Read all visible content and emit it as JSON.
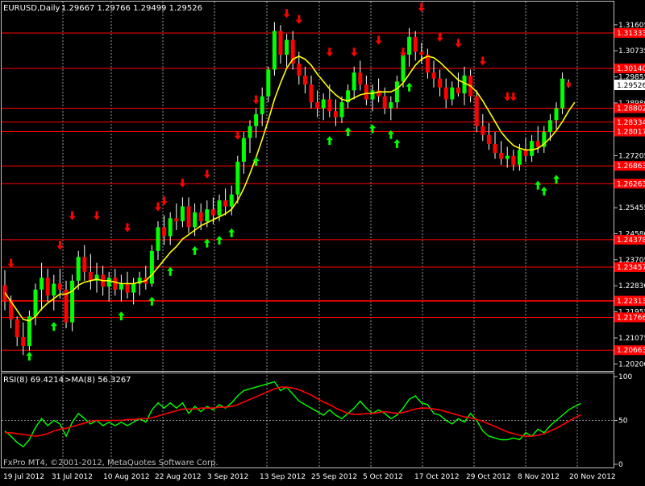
{
  "header": {
    "symbol": "EURUSD,Daily",
    "ohlc": "1.29667 1.29766 1.29499 1.29526"
  },
  "footer": {
    "copyright": "FxPro MT4, ©2001-2012, MetaQuotes Software Corp."
  },
  "colors": {
    "background": "#000000",
    "frame": "#c0c0c0",
    "bull": "#00ff00",
    "bear": "#ff0000",
    "ma_line": "#ffff00",
    "level_line": "#ff0000",
    "grid": "#c0c0c0",
    "rsi_line": "#00ff00",
    "rsi_ma_line": "#ff0000",
    "current_label_bg": "#ffffff"
  },
  "icons": {
    "up_arrow": "green-up-arrow-icon",
    "down_arrow": "red-down-arrow-icon"
  },
  "price_axis": {
    "ticks": [
      "1.31605",
      "1.30735",
      "1.29855",
      "1.28980",
      "1.28105",
      "1.27205",
      "1.26330",
      "1.25455",
      "1.24580",
      "1.23705",
      "1.22830",
      "1.21955",
      "1.21075",
      "1.20200"
    ],
    "level_labels": [
      "1.31333",
      "1.30140",
      "1.28802",
      "1.28334",
      "1.28017",
      "1.26863",
      "1.26263",
      "1.24378",
      "1.23457",
      "1.22330",
      "1.22313",
      "1.21766",
      "1.20663"
    ],
    "current_price": "1.29526"
  },
  "date_axis": {
    "labels": [
      "19 Jul 2012",
      "31 Jul 2012",
      "10 Aug 2012",
      "22 Aug 2012",
      "3 Sep 2012",
      "13 Sep 2012",
      "25 Sep 2012",
      "5 Oct 2012",
      "17 Oct 2012",
      "29 Oct 2012",
      "8 Nov 2012",
      "20 Nov 2012"
    ]
  },
  "rsi_panel": {
    "title": "RSI(8) 69.4214",
    "ma_title": ">MA(8) 56.3267",
    "ticks": [
      "100",
      "50",
      "0"
    ]
  },
  "chart_data": [
    {
      "type": "candlestick",
      "title": "EURUSD,Daily",
      "x": [
        "19 Jul 2012",
        "31 Jul 2012",
        "10 Aug 2012",
        "22 Aug 2012",
        "3 Sep 2012",
        "13 Sep 2012",
        "25 Sep 2012",
        "5 Oct 2012",
        "17 Oct 2012",
        "29 Oct 2012",
        "8 Nov 2012",
        "20 Nov 2012"
      ],
      "ylim": [
        1.201,
        1.319
      ],
      "grid": true,
      "candles": [
        {
          "o": 1.2285,
          "h": 1.2335,
          "l": 1.22,
          "c": 1.223
        },
        {
          "o": 1.223,
          "h": 1.225,
          "l": 1.214,
          "c": 1.217
        },
        {
          "o": 1.217,
          "h": 1.218,
          "l": 1.208,
          "c": 1.211
        },
        {
          "o": 1.211,
          "h": 1.216,
          "l": 1.205,
          "c": 1.208
        },
        {
          "o": 1.208,
          "h": 1.22,
          "l": 1.2065,
          "c": 1.218
        },
        {
          "o": 1.218,
          "h": 1.229,
          "l": 1.215,
          "c": 1.227
        },
        {
          "o": 1.227,
          "h": 1.236,
          "l": 1.22,
          "c": 1.231
        },
        {
          "o": 1.231,
          "h": 1.234,
          "l": 1.223,
          "c": 1.225
        },
        {
          "o": 1.225,
          "h": 1.232,
          "l": 1.22,
          "c": 1.229
        },
        {
          "o": 1.229,
          "h": 1.234,
          "l": 1.224,
          "c": 1.227
        },
        {
          "o": 1.227,
          "h": 1.23,
          "l": 1.214,
          "c": 1.216
        },
        {
          "o": 1.216,
          "h": 1.232,
          "l": 1.213,
          "c": 1.23
        },
        {
          "o": 1.23,
          "h": 1.24,
          "l": 1.227,
          "c": 1.238
        },
        {
          "o": 1.238,
          "h": 1.242,
          "l": 1.23,
          "c": 1.233
        },
        {
          "o": 1.233,
          "h": 1.239,
          "l": 1.227,
          "c": 1.23
        },
        {
          "o": 1.23,
          "h": 1.236,
          "l": 1.226,
          "c": 1.232
        },
        {
          "o": 1.232,
          "h": 1.235,
          "l": 1.225,
          "c": 1.228
        },
        {
          "o": 1.228,
          "h": 1.233,
          "l": 1.223,
          "c": 1.231
        },
        {
          "o": 1.231,
          "h": 1.234,
          "l": 1.225,
          "c": 1.227
        },
        {
          "o": 1.227,
          "h": 1.232,
          "l": 1.223,
          "c": 1.229
        },
        {
          "o": 1.229,
          "h": 1.233,
          "l": 1.224,
          "c": 1.226
        },
        {
          "o": 1.226,
          "h": 1.231,
          "l": 1.222,
          "c": 1.229
        },
        {
          "o": 1.229,
          "h": 1.233,
          "l": 1.225,
          "c": 1.231
        },
        {
          "o": 1.231,
          "h": 1.235,
          "l": 1.227,
          "c": 1.229
        },
        {
          "o": 1.229,
          "h": 1.242,
          "l": 1.228,
          "c": 1.24
        },
        {
          "o": 1.24,
          "h": 1.25,
          "l": 1.237,
          "c": 1.248
        },
        {
          "o": 1.248,
          "h": 1.252,
          "l": 1.242,
          "c": 1.245
        },
        {
          "o": 1.245,
          "h": 1.253,
          "l": 1.242,
          "c": 1.251
        },
        {
          "o": 1.251,
          "h": 1.256,
          "l": 1.247,
          "c": 1.25
        },
        {
          "o": 1.25,
          "h": 1.258,
          "l": 1.248,
          "c": 1.255
        },
        {
          "o": 1.255,
          "h": 1.258,
          "l": 1.246,
          "c": 1.248
        },
        {
          "o": 1.248,
          "h": 1.256,
          "l": 1.245,
          "c": 1.253
        },
        {
          "o": 1.253,
          "h": 1.256,
          "l": 1.247,
          "c": 1.25
        },
        {
          "o": 1.25,
          "h": 1.257,
          "l": 1.248,
          "c": 1.254
        },
        {
          "o": 1.254,
          "h": 1.258,
          "l": 1.249,
          "c": 1.252
        },
        {
          "o": 1.252,
          "h": 1.259,
          "l": 1.25,
          "c": 1.257
        },
        {
          "o": 1.257,
          "h": 1.261,
          "l": 1.252,
          "c": 1.255
        },
        {
          "o": 1.255,
          "h": 1.262,
          "l": 1.252,
          "c": 1.259
        },
        {
          "o": 1.259,
          "h": 1.272,
          "l": 1.256,
          "c": 1.27
        },
        {
          "o": 1.27,
          "h": 1.28,
          "l": 1.266,
          "c": 1.278
        },
        {
          "o": 1.278,
          "h": 1.284,
          "l": 1.273,
          "c": 1.282
        },
        {
          "o": 1.282,
          "h": 1.288,
          "l": 1.278,
          "c": 1.286
        },
        {
          "o": 1.286,
          "h": 1.295,
          "l": 1.282,
          "c": 1.292
        },
        {
          "o": 1.292,
          "h": 1.302,
          "l": 1.29,
          "c": 1.301
        },
        {
          "o": 1.301,
          "h": 1.317,
          "l": 1.299,
          "c": 1.314
        },
        {
          "o": 1.314,
          "h": 1.316,
          "l": 1.303,
          "c": 1.306
        },
        {
          "o": 1.306,
          "h": 1.313,
          "l": 1.302,
          "c": 1.311
        },
        {
          "o": 1.311,
          "h": 1.314,
          "l": 1.301,
          "c": 1.303
        },
        {
          "o": 1.303,
          "h": 1.307,
          "l": 1.296,
          "c": 1.299
        },
        {
          "o": 1.299,
          "h": 1.302,
          "l": 1.293,
          "c": 1.296
        },
        {
          "o": 1.296,
          "h": 1.299,
          "l": 1.288,
          "c": 1.29
        },
        {
          "o": 1.29,
          "h": 1.294,
          "l": 1.285,
          "c": 1.288
        },
        {
          "o": 1.288,
          "h": 1.293,
          "l": 1.284,
          "c": 1.291
        },
        {
          "o": 1.291,
          "h": 1.296,
          "l": 1.285,
          "c": 1.287
        },
        {
          "o": 1.287,
          "h": 1.291,
          "l": 1.282,
          "c": 1.285
        },
        {
          "o": 1.285,
          "h": 1.292,
          "l": 1.283,
          "c": 1.29
        },
        {
          "o": 1.29,
          "h": 1.296,
          "l": 1.288,
          "c": 1.294
        },
        {
          "o": 1.294,
          "h": 1.302,
          "l": 1.291,
          "c": 1.3
        },
        {
          "o": 1.3,
          "h": 1.304,
          "l": 1.294,
          "c": 1.296
        },
        {
          "o": 1.296,
          "h": 1.299,
          "l": 1.289,
          "c": 1.291
        },
        {
          "o": 1.291,
          "h": 1.296,
          "l": 1.287,
          "c": 1.294
        },
        {
          "o": 1.294,
          "h": 1.298,
          "l": 1.29,
          "c": 1.292
        },
        {
          "o": 1.292,
          "h": 1.295,
          "l": 1.286,
          "c": 1.288
        },
        {
          "o": 1.288,
          "h": 1.292,
          "l": 1.284,
          "c": 1.29
        },
        {
          "o": 1.29,
          "h": 1.299,
          "l": 1.288,
          "c": 1.297
        },
        {
          "o": 1.297,
          "h": 1.308,
          "l": 1.295,
          "c": 1.306
        },
        {
          "o": 1.306,
          "h": 1.315,
          "l": 1.302,
          "c": 1.312
        },
        {
          "o": 1.312,
          "h": 1.314,
          "l": 1.304,
          "c": 1.307
        },
        {
          "o": 1.307,
          "h": 1.31,
          "l": 1.303,
          "c": 1.306
        },
        {
          "o": 1.306,
          "h": 1.308,
          "l": 1.298,
          "c": 1.3
        },
        {
          "o": 1.3,
          "h": 1.304,
          "l": 1.295,
          "c": 1.298
        },
        {
          "o": 1.298,
          "h": 1.301,
          "l": 1.292,
          "c": 1.295
        },
        {
          "o": 1.295,
          "h": 1.298,
          "l": 1.288,
          "c": 1.291
        },
        {
          "o": 1.291,
          "h": 1.297,
          "l": 1.289,
          "c": 1.295
        },
        {
          "o": 1.295,
          "h": 1.3,
          "l": 1.292,
          "c": 1.293
        },
        {
          "o": 1.293,
          "h": 1.302,
          "l": 1.289,
          "c": 1.299
        },
        {
          "o": 1.299,
          "h": 1.301,
          "l": 1.29,
          "c": 1.292
        },
        {
          "o": 1.292,
          "h": 1.294,
          "l": 1.28,
          "c": 1.282
        },
        {
          "o": 1.282,
          "h": 1.286,
          "l": 1.277,
          "c": 1.279
        },
        {
          "o": 1.279,
          "h": 1.283,
          "l": 1.274,
          "c": 1.276
        },
        {
          "o": 1.276,
          "h": 1.28,
          "l": 1.271,
          "c": 1.273
        },
        {
          "o": 1.273,
          "h": 1.277,
          "l": 1.269,
          "c": 1.271
        },
        {
          "o": 1.271,
          "h": 1.275,
          "l": 1.268,
          "c": 1.272
        },
        {
          "o": 1.272,
          "h": 1.274,
          "l": 1.267,
          "c": 1.269
        },
        {
          "o": 1.269,
          "h": 1.276,
          "l": 1.267,
          "c": 1.274
        },
        {
          "o": 1.274,
          "h": 1.278,
          "l": 1.27,
          "c": 1.272
        },
        {
          "o": 1.272,
          "h": 1.279,
          "l": 1.27,
          "c": 1.277
        },
        {
          "o": 1.277,
          "h": 1.282,
          "l": 1.273,
          "c": 1.275
        },
        {
          "o": 1.275,
          "h": 1.282,
          "l": 1.273,
          "c": 1.28
        },
        {
          "o": 1.28,
          "h": 1.286,
          "l": 1.277,
          "c": 1.284
        },
        {
          "o": 1.284,
          "h": 1.29,
          "l": 1.281,
          "c": 1.288
        },
        {
          "o": 1.288,
          "h": 1.3,
          "l": 1.286,
          "c": 1.298
        },
        {
          "o": 1.2967,
          "h": 1.2977,
          "l": 1.295,
          "c": 1.2953
        }
      ],
      "ma_values": [
        1.226,
        1.223,
        1.22,
        1.217,
        1.2165,
        1.218,
        1.2205,
        1.2225,
        1.224,
        1.2255,
        1.2255,
        1.2265,
        1.2285,
        1.2295,
        1.23,
        1.2305,
        1.23,
        1.23,
        1.2295,
        1.229,
        1.229,
        1.229,
        1.2295,
        1.23,
        1.232,
        1.2345,
        1.237,
        1.2395,
        1.2415,
        1.244,
        1.2455,
        1.247,
        1.2485,
        1.2495,
        1.2505,
        1.2515,
        1.2525,
        1.254,
        1.257,
        1.261,
        1.266,
        1.2715,
        1.2775,
        1.284,
        1.291,
        1.2965,
        1.3015,
        1.3045,
        1.3055,
        1.3045,
        1.3025,
        1.2995,
        1.297,
        1.2945,
        1.2925,
        1.291,
        1.2905,
        1.2915,
        1.2925,
        1.293,
        1.293,
        1.2935,
        1.2935,
        1.2935,
        1.2945,
        1.2965,
        1.2995,
        1.3025,
        1.3045,
        1.3055,
        1.305,
        1.3035,
        1.3015,
        1.2995,
        1.2975,
        1.2965,
        1.2955,
        1.2935,
        1.2905,
        1.287,
        1.2835,
        1.28,
        1.2775,
        1.2755,
        1.2745,
        1.274,
        1.274,
        1.2745,
        1.276,
        1.278,
        1.2805,
        1.2835,
        1.287,
        1.29
      ],
      "up_arrows": [
        [
          4,
          1.2045
        ],
        [
          8,
          1.2145
        ],
        [
          19,
          1.218
        ],
        [
          24,
          1.223
        ],
        [
          27,
          1.233
        ],
        [
          31,
          1.24
        ],
        [
          33,
          1.2425
        ],
        [
          35,
          1.2435
        ],
        [
          37,
          1.246
        ],
        [
          41,
          1.27
        ],
        [
          53,
          1.277
        ],
        [
          56,
          1.28
        ],
        [
          60,
          1.281
        ],
        [
          63,
          1.279
        ],
        [
          64,
          1.276
        ],
        [
          66,
          1.295
        ],
        [
          87,
          1.262
        ],
        [
          88,
          1.26
        ],
        [
          90,
          1.264
        ]
      ],
      "down_arrows": [
        [
          1,
          1.236
        ],
        [
          9,
          1.242
        ],
        [
          11,
          1.252
        ],
        [
          15,
          1.252
        ],
        [
          20,
          1.248
        ],
        [
          25,
          1.255
        ],
        [
          26,
          1.257
        ],
        [
          29,
          1.263
        ],
        [
          33,
          1.266
        ],
        [
          38,
          1.279
        ],
        [
          41,
          1.291
        ],
        [
          46,
          1.32
        ],
        [
          48,
          1.318
        ],
        [
          53,
          1.307
        ],
        [
          57,
          1.307
        ],
        [
          61,
          1.311
        ],
        [
          65,
          1.307
        ],
        [
          68,
          1.322
        ],
        [
          71,
          1.312
        ],
        [
          74,
          1.31
        ],
        [
          78,
          1.304
        ],
        [
          82,
          1.292
        ],
        [
          83,
          1.292
        ]
      ]
    },
    {
      "type": "line",
      "title": "RSI(8) 69.4214",
      "ylim": [
        0,
        100
      ],
      "series": [
        {
          "name": "RSI(8)",
          "values": [
            38,
            32,
            25,
            20,
            28,
            42,
            52,
            44,
            50,
            46,
            32,
            48,
            58,
            52,
            46,
            50,
            44,
            48,
            44,
            48,
            44,
            48,
            52,
            48,
            62,
            70,
            64,
            70,
            64,
            70,
            58,
            66,
            60,
            66,
            62,
            68,
            64,
            70,
            78,
            84,
            86,
            88,
            90,
            92,
            94,
            84,
            88,
            80,
            72,
            68,
            64,
            60,
            56,
            62,
            56,
            52,
            58,
            64,
            72,
            64,
            58,
            62,
            58,
            52,
            56,
            64,
            74,
            78,
            70,
            68,
            58,
            56,
            50,
            46,
            52,
            48,
            58,
            50,
            38,
            32,
            30,
            28,
            28,
            30,
            28,
            36,
            32,
            40,
            36,
            44,
            50,
            56,
            62,
            66,
            69.4
          ]
        },
        {
          "name": "MA(8)",
          "values": [
            36,
            36,
            35,
            34,
            33,
            32,
            33,
            35,
            38,
            40,
            41,
            43,
            45,
            47,
            49,
            50,
            50,
            50,
            50,
            50,
            51,
            51,
            52,
            52,
            53,
            55,
            57,
            59,
            61,
            63,
            63,
            63,
            64,
            64,
            64,
            65,
            65,
            66,
            68,
            71,
            74,
            77,
            80,
            83,
            86,
            88,
            88,
            87,
            85,
            82,
            79,
            75,
            71,
            68,
            64,
            61,
            58,
            57,
            57,
            58,
            58,
            59,
            60,
            59,
            58,
            59,
            61,
            63,
            64,
            64,
            63,
            62,
            60,
            58,
            56,
            54,
            53,
            51,
            49,
            46,
            43,
            40,
            37,
            35,
            33,
            32,
            32,
            33,
            35,
            38,
            41,
            45,
            49,
            53,
            56.3
          ]
        }
      ]
    }
  ]
}
